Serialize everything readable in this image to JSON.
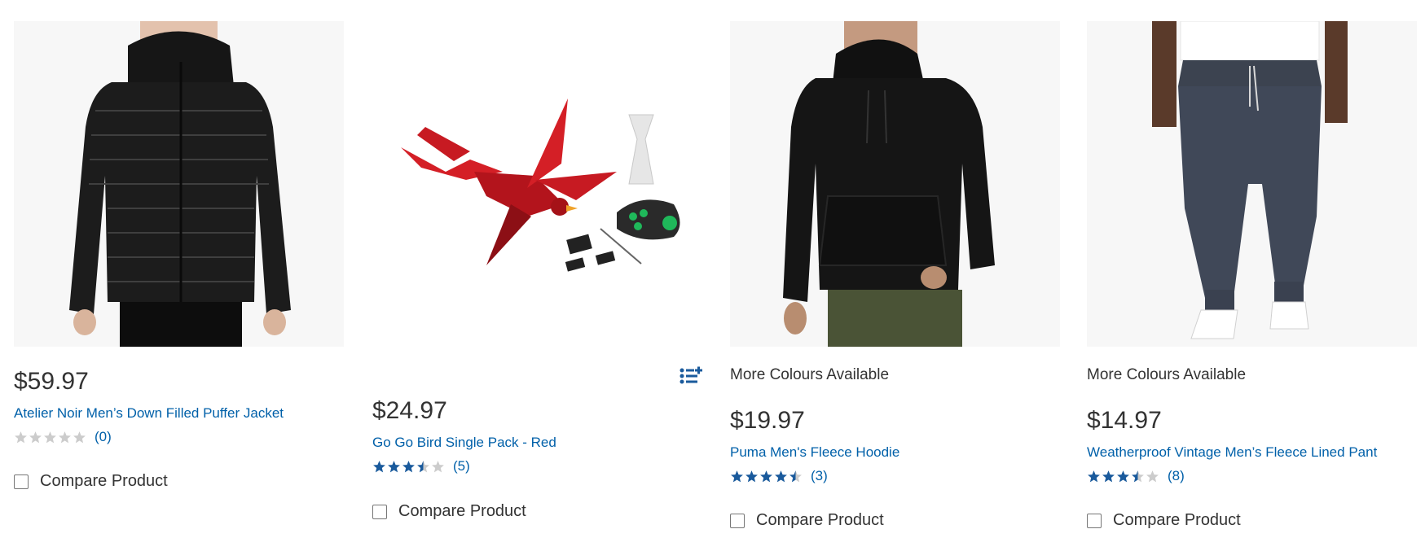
{
  "products": [
    {
      "image_alt": "Atelier Noir Men’s Down Filled Puffer Jacket",
      "colours_text": "",
      "price": "$59.97",
      "title": "Atelier Noir Men’s Down Filled Puffer Jacket",
      "rating": 0,
      "review_count": "(0)",
      "compare_label": "Compare Product"
    },
    {
      "image_alt": "Go Go Bird Single Pack - Red",
      "colours_text": "",
      "price": "$24.97",
      "title": "Go Go Bird Single Pack - Red",
      "rating": 3.5,
      "review_count": "(5)",
      "compare_label": "Compare Product",
      "has_list_icon": true
    },
    {
      "image_alt": "Puma Men's Fleece Hoodie",
      "colours_text": "More Colours Available",
      "price": "$19.97",
      "title": "Puma Men's Fleece Hoodie",
      "rating": 4.5,
      "review_count": "(3)",
      "compare_label": "Compare Product"
    },
    {
      "image_alt": "Weatherproof Vintage Men’s Fleece Lined Pant",
      "colours_text": "More Colours Available",
      "price": "$14.97",
      "title": "Weatherproof Vintage Men’s Fleece Lined Pant",
      "rating": 3.5,
      "review_count": "(8)",
      "compare_label": "Compare Product"
    }
  ],
  "colors": {
    "link": "#0060a9",
    "star_filled": "#1a5a9c",
    "star_empty": "#cccccc",
    "text": "#333333"
  }
}
